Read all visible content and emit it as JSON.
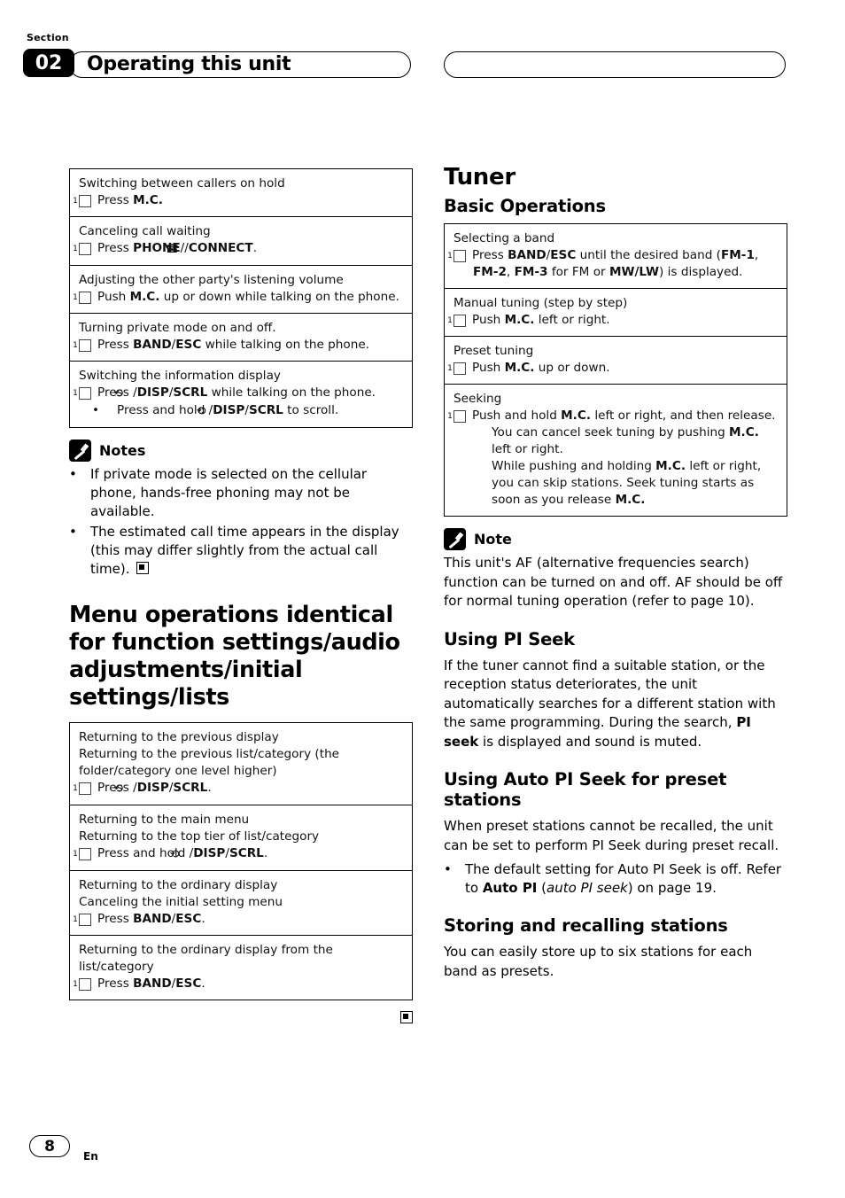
{
  "header": {
    "section_label": "Section",
    "section_number": "02",
    "title": "Operating this unit"
  },
  "footer": {
    "page_number": "8",
    "language": "En"
  },
  "left_column": {
    "phone_table": [
      {
        "title": "Switching between callers on hold",
        "lines": [
          {
            "step": "1",
            "html": "Press <b>M.C.</b>"
          }
        ]
      },
      {
        "title": "Canceling call waiting",
        "lines": [
          {
            "step": "1",
            "html": "Press <b>PHONE</b>/<span class=\"ret-icon\">☎</span>/<b>CONNECT</b>."
          }
        ]
      },
      {
        "title": "Adjusting the other party's listening volume",
        "lines": [
          {
            "step": "1",
            "html": "Push <b>M.C.</b> up or down while talking on the phone."
          }
        ]
      },
      {
        "title": "Turning private mode on and off.",
        "lines": [
          {
            "step": "1",
            "html": "Press <b>BAND</b>/<b>ESC</b> while talking on the phone."
          }
        ]
      },
      {
        "title": "Switching the information display",
        "lines": [
          {
            "step": "1",
            "html": "Press <span class=\"ret-icon\">⟲</span>/<b>DISP</b>/<b>SCRL</b> while talking on the phone."
          },
          {
            "bullet": true,
            "html": "Press and hold <span class=\"ret-icon\">⟲</span>/<b>DISP</b>/<b>SCRL</b> to scroll."
          }
        ]
      }
    ],
    "notes_title": "Notes",
    "notes": [
      "If private mode is selected on the cellular phone, hands-free phoning may not be available.",
      "The estimated call time appears in the display (this may differ slightly from the actual call time)."
    ],
    "menu_heading": "Menu operations identical for function settings/audio adjustments/initial settings/lists",
    "menu_table": [
      {
        "title": "Returning to the previous display",
        "subtitle": "Returning to the previous list/category (the folder/category one level higher)",
        "lines": [
          {
            "step": "1",
            "html": "Press <span class=\"ret-icon\">⟲</span>/<b>DISP</b>/<b>SCRL</b>."
          }
        ]
      },
      {
        "title": "Returning to the main menu",
        "subtitle": "Returning to the top tier of list/category",
        "lines": [
          {
            "step": "1",
            "html": "Press and hold <span class=\"ret-icon\">⟲</span>/<b>DISP</b>/<b>SCRL</b>."
          }
        ]
      },
      {
        "title": "Returning to the ordinary display",
        "subtitle": "Canceling the initial setting menu",
        "lines": [
          {
            "step": "1",
            "html": "Press <b>BAND</b>/<b>ESC</b>."
          }
        ]
      },
      {
        "title": "Returning to the ordinary display from the list/category",
        "subtitle": "",
        "lines": [
          {
            "step": "1",
            "html": "Press <b>BAND</b>/<b>ESC</b>."
          }
        ]
      }
    ]
  },
  "right_column": {
    "tuner_title": "Tuner",
    "basic_operations_title": "Basic Operations",
    "basic_table": [
      {
        "title": "Selecting a band",
        "lines": [
          {
            "step": "1",
            "html": "Press <b>BAND</b>/<b>ESC</b> until the desired band (<b>FM-1</b>, <b>FM-2</b>, <b>FM-3</b> for FM or <b>MW/LW</b>) is displayed."
          }
        ]
      },
      {
        "title": "Manual tuning (step by step)",
        "lines": [
          {
            "step": "1",
            "html": "Push <b>M.C.</b> left or right."
          }
        ]
      },
      {
        "title": "Preset tuning",
        "lines": [
          {
            "step": "1",
            "html": "Push <b>M.C.</b> up or down."
          }
        ]
      },
      {
        "title": "Seeking",
        "lines": [
          {
            "step": "1",
            "html": "Push and hold <b>M.C.</b> left or right, and then release."
          },
          {
            "sub": true,
            "html": "You can cancel seek tuning by pushing <b>M.C.</b> left or right."
          },
          {
            "sub": true,
            "html": "While pushing and holding <b>M.C.</b> left or right, you can skip stations. Seek tuning starts as soon as you release <b>M.C.</b>"
          }
        ]
      }
    ],
    "note_title": "Note",
    "note_text": "This unit's AF (alternative frequencies search) function can be turned on and off. AF should be off for normal tuning operation (refer to page 10).",
    "pi_seek_title": "Using PI Seek",
    "pi_seek_text_html": "If the tuner cannot find a suitable station, or the reception status deteriorates, the unit automatically searches for a different station with the same programming. During the search, <b>PI seek</b> is displayed and sound is muted.",
    "auto_pi_title": "Using Auto PI Seek for preset stations",
    "auto_pi_text": "When preset stations cannot be recalled, the unit can be set to perform PI Seek during preset recall.",
    "auto_pi_bullet_html": "The default setting for Auto PI Seek is off. Refer to <b>Auto PI</b> (<i>auto PI seek</i>) on page 19.",
    "storing_title": "Storing and recalling stations",
    "storing_text": "You can easily store up to six stations for each band as presets."
  }
}
